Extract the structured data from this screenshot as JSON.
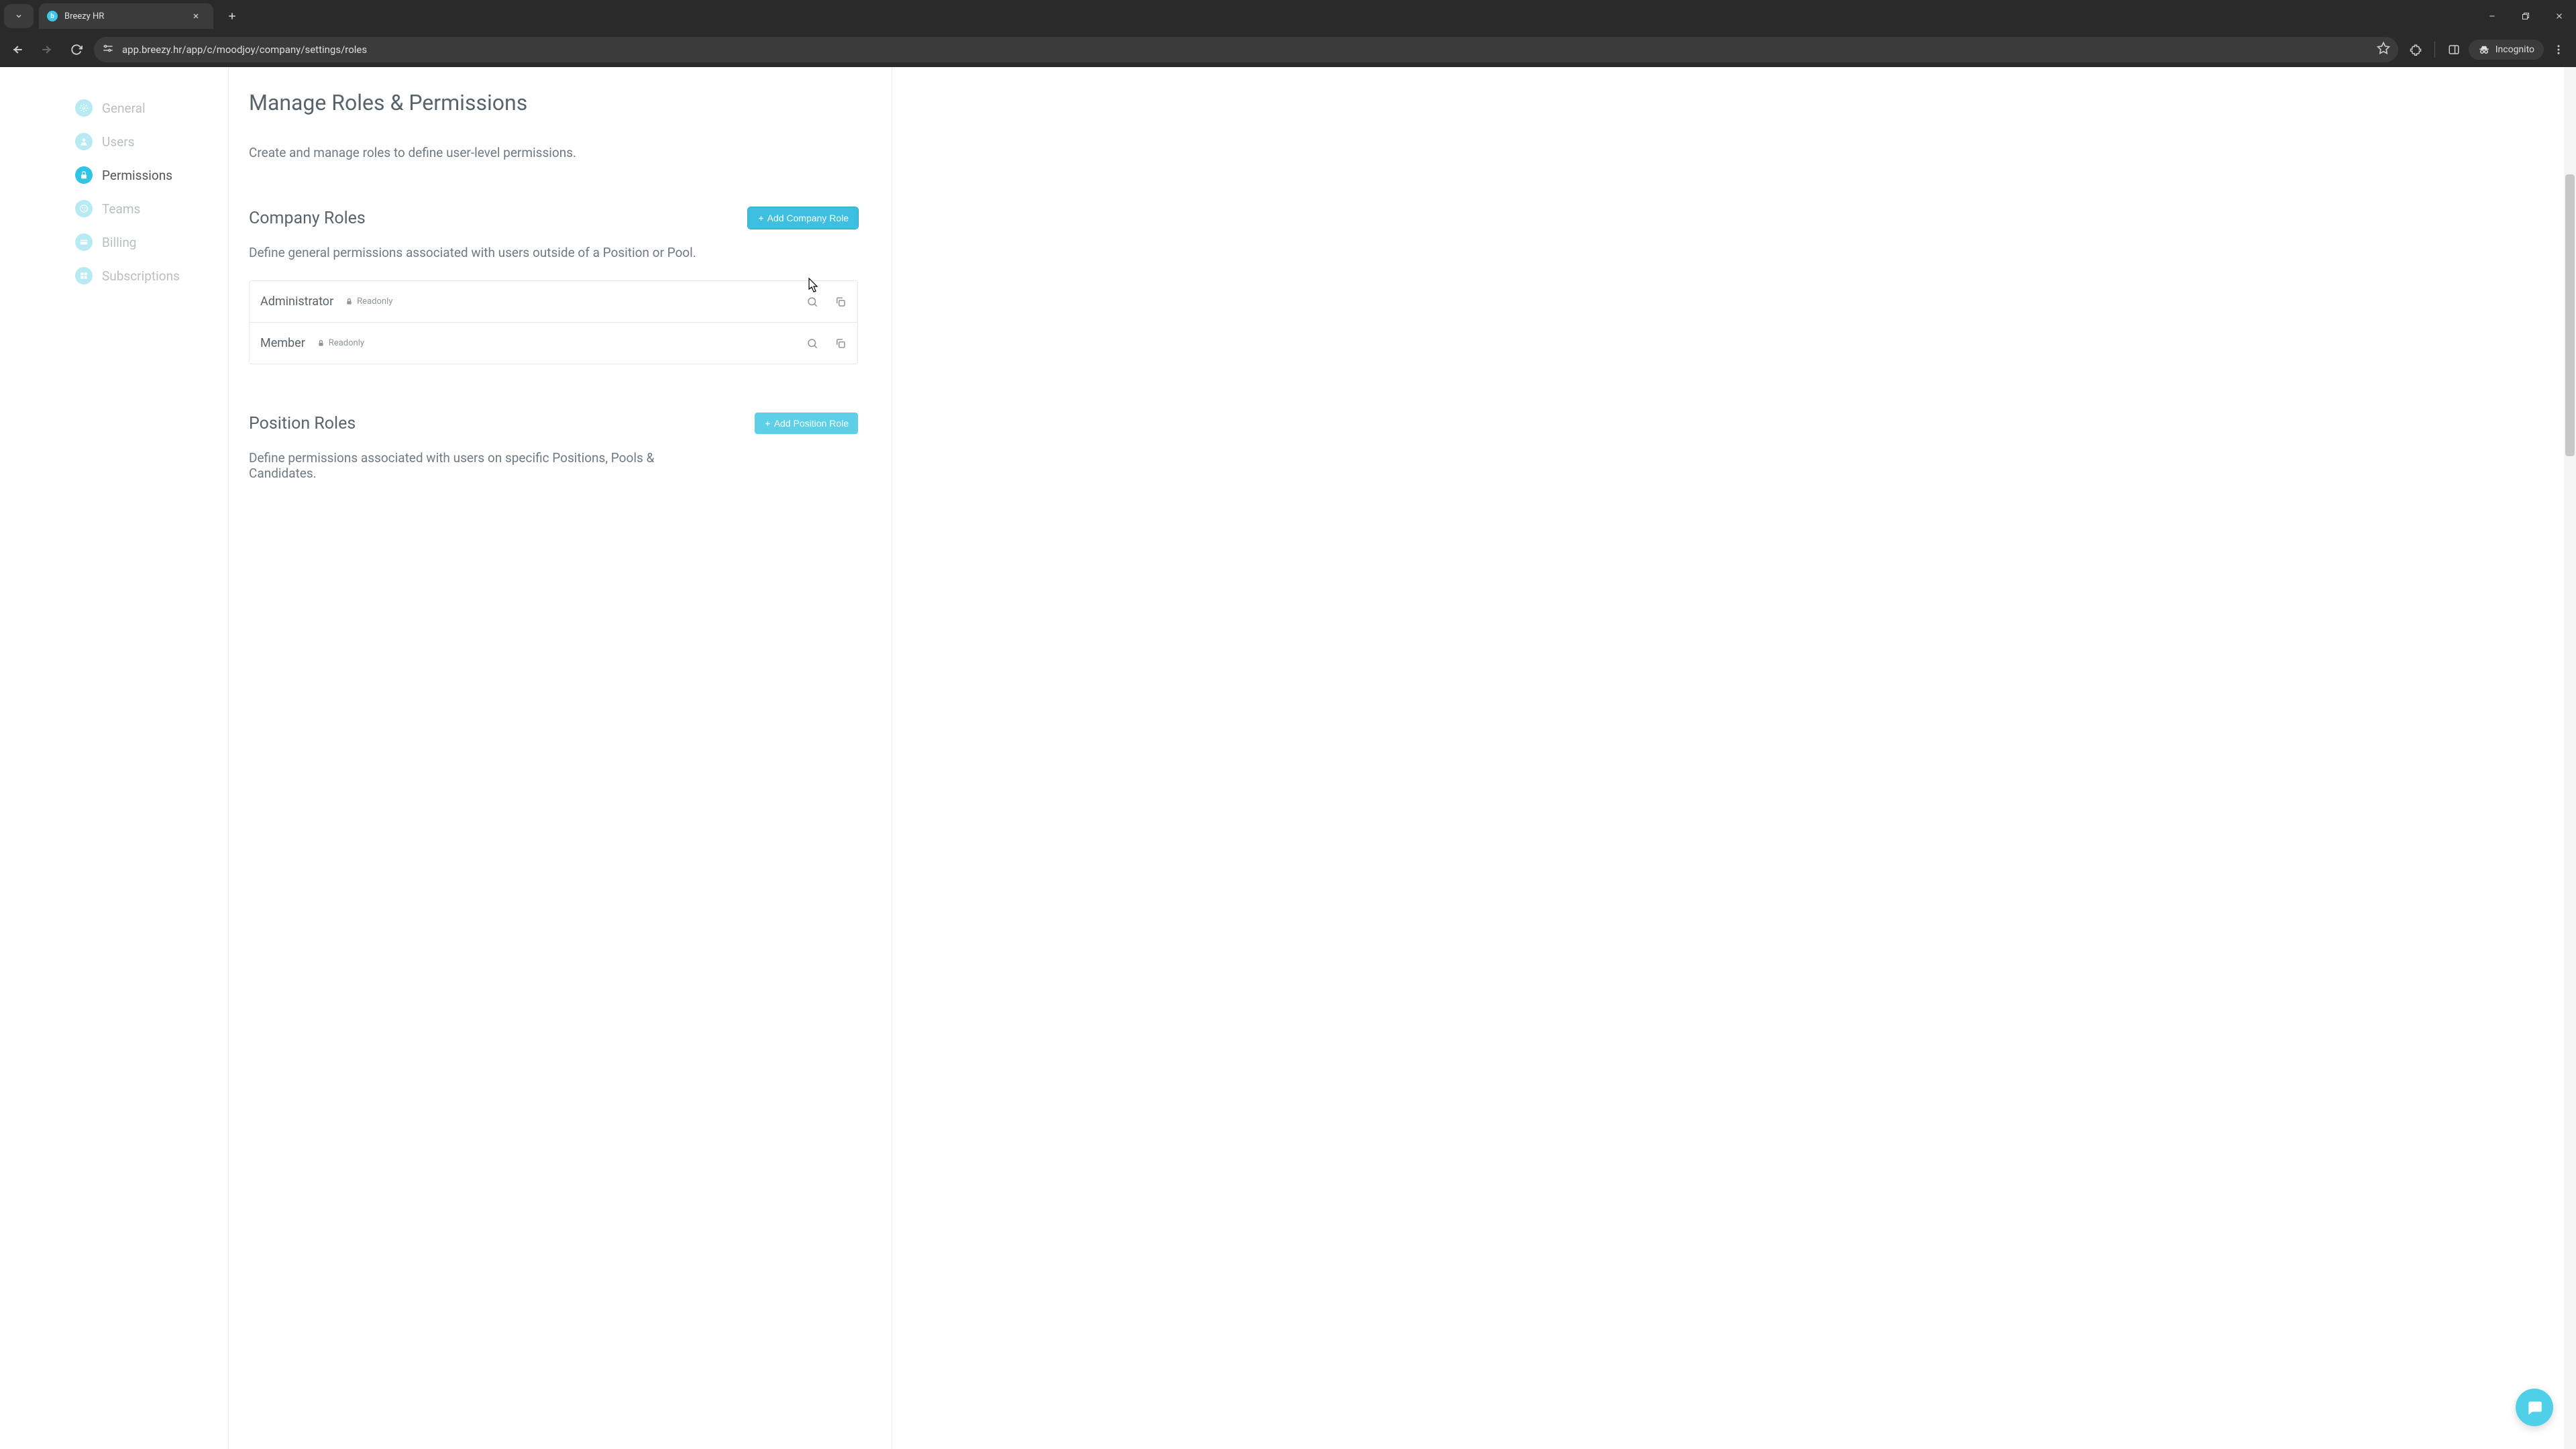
{
  "browser": {
    "tab_title": "Breezy HR",
    "url": "app.breezy.hr/app/c/moodjoy/company/settings/roles",
    "incognito_label": "Incognito"
  },
  "sidebar": {
    "items": [
      {
        "label": "General",
        "icon": "gear"
      },
      {
        "label": "Users",
        "icon": "user"
      },
      {
        "label": "Permissions",
        "icon": "lock",
        "active": true
      },
      {
        "label": "Teams",
        "icon": "circle-x"
      },
      {
        "label": "Billing",
        "icon": "card"
      },
      {
        "label": "Subscriptions",
        "icon": "grid"
      }
    ]
  },
  "page": {
    "title": "Manage Roles & Permissions",
    "subtitle": "Create and manage roles to define user-level permissions."
  },
  "company": {
    "title": "Company Roles",
    "add_label": "Add Company Role",
    "subtitle": "Define general permissions associated with users outside of a Position or Pool.",
    "roles": [
      {
        "name": "Administrator",
        "readonly": "Readonly"
      },
      {
        "name": "Member",
        "readonly": "Readonly"
      }
    ]
  },
  "position": {
    "title": "Position Roles",
    "add_label": "Add Position Role",
    "subtitle": "Define permissions associated with users on specific Positions, Pools & Candidates."
  }
}
